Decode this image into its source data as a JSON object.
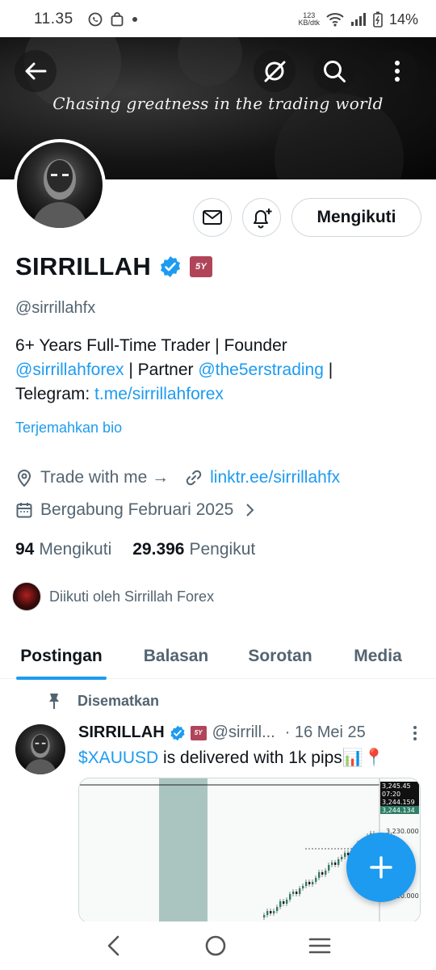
{
  "status_bar": {
    "time": "11.35",
    "net_speed_value": "123",
    "net_speed_unit": "KB/dtk",
    "battery": "14%"
  },
  "banner": {
    "tagline": "Chasing greatness in the trading world"
  },
  "profile": {
    "name": "SIRRILLAH",
    "handle": "@sirrillahfx",
    "badge_label": "5Y",
    "follow_button": "Mengikuti",
    "bio_line1": "6+ Years Full-Time Trader | Founder",
    "bio_mention1": "@sirrillahforex",
    "bio_partner": " | Partner ",
    "bio_mention2": "@the5erstrading",
    "bio_sep": " |",
    "bio_telegram_label": "Telegram: ",
    "bio_telegram_link": "t.me/sirrillahforex",
    "translate_bio": "Terjemahkan bio",
    "location": "Trade with me →",
    "website": "linktr.ee/sirrillahfx",
    "joined": "Bergabung Februari 2025",
    "following_count": "94",
    "following_label": "Mengikuti",
    "followers_count": "29.396",
    "followers_label": "Pengikut",
    "followed_by": "Diikuti oleh Sirrillah Forex"
  },
  "tabs": [
    "Postingan",
    "Balasan",
    "Sorotan",
    "Media"
  ],
  "post": {
    "pinned_label": "Disematkan",
    "author": "SIRRILLAH",
    "handle": "@sirrill...",
    "date": "· 16 Mei 25",
    "text_cashtag": "$XAUUSD",
    "text_body": " is delivered with 1k pips📊📍",
    "chart_prices": [
      "3,245.45",
      "07:20",
      "3,244.159",
      "3,244.134",
      "3,230.000",
      "3,220.000"
    ]
  },
  "colors": {
    "accent": "#1d9bf0",
    "text_primary": "#0f1419",
    "text_secondary": "#536471"
  }
}
